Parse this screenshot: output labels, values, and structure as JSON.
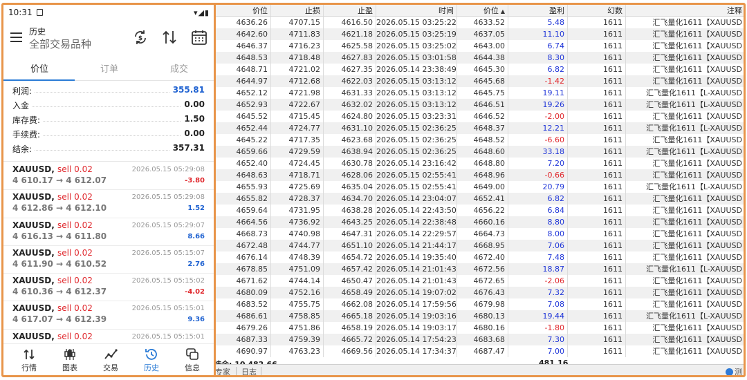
{
  "phone": {
    "status": {
      "time": "10:31",
      "icons": "▾◢▮"
    },
    "appbar": {
      "title": "历史",
      "subtitle": "全部交易品种"
    },
    "tabs": [
      {
        "label": "价位"
      },
      {
        "label": "订单"
      },
      {
        "label": "成交"
      }
    ],
    "summary": [
      {
        "label": "利润:",
        "value": "355.81"
      },
      {
        "label": "入金",
        "value": "0.00"
      },
      {
        "label": "库存费:",
        "value": "1.50"
      },
      {
        "label": "手续费:",
        "value": "0.00"
      },
      {
        "label": "结余:",
        "value": "357.31"
      }
    ],
    "deals": [
      {
        "symbol": "XAUUSD,",
        "side": "sell 0.02",
        "date": "2026.05.15 05:29:08",
        "prices": "4 610.17 → 4 612.07",
        "profit": "-3.80"
      },
      {
        "symbol": "XAUUSD,",
        "side": "sell 0.02",
        "date": "2026.05.15 05:29:08",
        "prices": "4 612.86 → 4 612.10",
        "profit": "1.52"
      },
      {
        "symbol": "XAUUSD,",
        "side": "sell 0.02",
        "date": "2026.05.15 05:29:07",
        "prices": "4 616.13 → 4 611.80",
        "profit": "8.66"
      },
      {
        "symbol": "XAUUSD,",
        "side": "sell 0.02",
        "date": "2026.05.15 05:15:07",
        "prices": "4 611.90 → 4 610.52",
        "profit": "2.76"
      },
      {
        "symbol": "XAUUSD,",
        "side": "sell 0.02",
        "date": "2026.05.15 05:15:02",
        "prices": "4 610.36 → 4 612.37",
        "profit": "-4.02"
      },
      {
        "symbol": "XAUUSD,",
        "side": "sell 0.02",
        "date": "2026.05.15 05:15:01",
        "prices": "4 617.07 → 4 612.39",
        "profit": "9.36"
      },
      {
        "symbol": "XAUUSD,",
        "side": "sell 0.02",
        "date": "2026.05.15 05:15:01",
        "prices": "",
        "profit": ""
      }
    ],
    "nav": [
      {
        "label": "行情"
      },
      {
        "label": "图表"
      },
      {
        "label": "交易"
      },
      {
        "label": "历史"
      },
      {
        "label": "信息"
      }
    ]
  },
  "table": {
    "columns": [
      "价位",
      "止损",
      "止盈",
      "时间",
      "价位",
      "盈利",
      "幻数",
      "注释"
    ],
    "rows": [
      [
        "4636.26",
        "4707.15",
        "4616.50",
        "2026.05.15 03:25:22",
        "4633.52",
        "5.48",
        "1611",
        "汇飞量化1611【XAUUSD"
      ],
      [
        "4642.60",
        "4711.83",
        "4621.18",
        "2026.05.15 03:25:19",
        "4637.05",
        "11.10",
        "1611",
        "汇飞量化1611【XAUUSD"
      ],
      [
        "4646.37",
        "4716.23",
        "4625.58",
        "2026.05.15 03:25:02",
        "4643.00",
        "6.74",
        "1611",
        "汇飞量化1611【XAUUSD"
      ],
      [
        "4648.53",
        "4718.48",
        "4627.83",
        "2026.05.15 03:01:58",
        "4644.38",
        "8.30",
        "1611",
        "汇飞量化1611【XAUUSD"
      ],
      [
        "4648.71",
        "4721.02",
        "4627.35",
        "2026.05.14 23:38:49",
        "4645.30",
        "6.82",
        "1611",
        "汇飞量化1611【XAUUSD"
      ],
      [
        "4644.97",
        "4712.68",
        "4622.03",
        "2026.05.15 03:13:12",
        "4645.68",
        "-1.42",
        "1611",
        "汇飞量化1611【XAUUSD"
      ],
      [
        "4652.12",
        "4721.98",
        "4631.33",
        "2026.05.15 03:13:12",
        "4645.75",
        "19.11",
        "1611",
        "汇飞量化1611【L-XAUUSD"
      ],
      [
        "4652.93",
        "4722.67",
        "4632.02",
        "2026.05.15 03:13:12",
        "4646.51",
        "19.26",
        "1611",
        "汇飞量化1611【L-XAUUSD"
      ],
      [
        "4645.52",
        "4715.45",
        "4624.80",
        "2026.05.15 03:23:31",
        "4646.52",
        "-2.00",
        "1611",
        "汇飞量化1611【XAUUSD"
      ],
      [
        "4652.44",
        "4724.77",
        "4631.10",
        "2026.05.15 02:36:25",
        "4648.37",
        "12.21",
        "1611",
        "汇飞量化1611【L-XAUUSD"
      ],
      [
        "4645.22",
        "4717.35",
        "4623.68",
        "2026.05.15 02:36:25",
        "4648.52",
        "-6.60",
        "1611",
        "汇飞量化1611【XAUUSD"
      ],
      [
        "4659.66",
        "4729.59",
        "4638.94",
        "2026.05.15 02:36:25",
        "4648.60",
        "33.18",
        "1611",
        "汇飞量化1611【L-XAUUSD"
      ],
      [
        "4652.40",
        "4724.45",
        "4630.78",
        "2026.05.14 23:16:42",
        "4648.80",
        "7.20",
        "1611",
        "汇飞量化1611【XAUUSD"
      ],
      [
        "4648.63",
        "4718.71",
        "4628.06",
        "2026.05.15 02:55:41",
        "4648.96",
        "-0.66",
        "1611",
        "汇飞量化1611【XAUUSD"
      ],
      [
        "4655.93",
        "4725.69",
        "4635.04",
        "2026.05.15 02:55:41",
        "4649.00",
        "20.79",
        "1611",
        "汇飞量化1611【L-XAUUSD"
      ],
      [
        "4655.82",
        "4728.37",
        "4634.70",
        "2026.05.14 23:04:07",
        "4652.41",
        "6.82",
        "1611",
        "汇飞量化1611【XAUUSD"
      ],
      [
        "4659.64",
        "4731.95",
        "4638.28",
        "2026.05.14 22:43:50",
        "4656.22",
        "6.84",
        "1611",
        "汇飞量化1611【XAUUSD"
      ],
      [
        "4664.56",
        "4736.92",
        "4643.25",
        "2026.05.14 22:38:48",
        "4660.16",
        "8.80",
        "1611",
        "汇飞量化1611【XAUUSD"
      ],
      [
        "4668.73",
        "4740.98",
        "4647.31",
        "2026.05.14 22:29:57",
        "4664.73",
        "8.00",
        "1611",
        "汇飞量化1611【XAUUSD"
      ],
      [
        "4672.48",
        "4744.77",
        "4651.10",
        "2026.05.14 21:44:17",
        "4668.95",
        "7.06",
        "1611",
        "汇飞量化1611【XAUUSD"
      ],
      [
        "4676.14",
        "4748.39",
        "4654.72",
        "2026.05.14 19:35:40",
        "4672.40",
        "7.48",
        "1611",
        "汇飞量化1611【XAUUSD"
      ],
      [
        "4678.85",
        "4751.09",
        "4657.42",
        "2026.05.14 21:01:43",
        "4672.56",
        "18.87",
        "1611",
        "汇飞量化1611【L-XAUUSD"
      ],
      [
        "4671.62",
        "4744.14",
        "4650.47",
        "2026.05.14 21:01:43",
        "4672.65",
        "-2.06",
        "1611",
        "汇飞量化1611【XAUUSD"
      ],
      [
        "4680.09",
        "4752.16",
        "4658.49",
        "2026.05.14 19:07:02",
        "4676.43",
        "7.32",
        "1611",
        "汇飞量化1611【XAUUSD"
      ],
      [
        "4683.52",
        "4755.75",
        "4662.08",
        "2026.05.14 17:59:56",
        "4679.98",
        "7.08",
        "1611",
        "汇飞量化1611【XAUUSD"
      ],
      [
        "4686.61",
        "4758.85",
        "4665.18",
        "2026.05.14 19:03:16",
        "4680.13",
        "19.44",
        "1611",
        "汇飞量化1611【L-XAUUSD"
      ],
      [
        "4679.26",
        "4751.86",
        "4658.19",
        "2026.05.14 19:03:17",
        "4680.16",
        "-1.80",
        "1611",
        "汇飞量化1611【XAUUSD"
      ],
      [
        "4687.33",
        "4759.39",
        "4665.72",
        "2026.05.14 17:54:23",
        "4683.68",
        "7.30",
        "1611",
        "汇飞量化1611【XAUUSD"
      ],
      [
        "4690.97",
        "4763.23",
        "4669.56",
        "2026.05.14 17:34:37",
        "4687.47",
        "7.00",
        "1611",
        "汇飞量化1611【XAUUSD"
      ]
    ],
    "summary": {
      "balance": "结余: 10 482.66",
      "total": "481.16"
    },
    "bottom_tabs": [
      "专家",
      "日志"
    ],
    "test_label": "测"
  },
  "colors": {
    "accent_orange": "#e8954a",
    "profit_blue": "#1f35d8",
    "loss_red": "#e0282d",
    "active_blue": "#2a7bd6"
  }
}
